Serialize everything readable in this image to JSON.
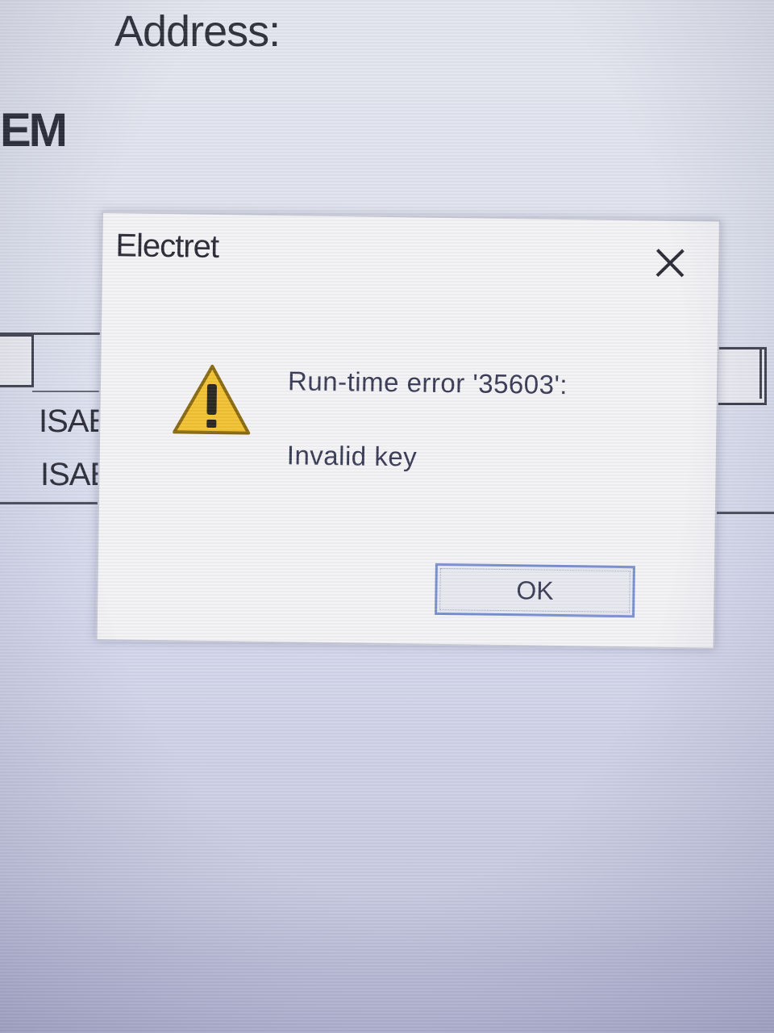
{
  "background_window": {
    "address_label": "Address:",
    "em_label": "EM",
    "rows": [
      "ISAE",
      "ISAE"
    ]
  },
  "dialog": {
    "title": "Electret",
    "close_icon": "close-x-icon",
    "warning_icon": "warning-triangle-icon",
    "message": "Run-time error '35603':",
    "detail": "Invalid key",
    "ok_label": "OK"
  },
  "colors": {
    "screen_background": "#dfe2ee",
    "dialog_background": "#f3f3f6",
    "warning_yellow": "#f2c233",
    "ok_border": "#7a8fd0"
  }
}
